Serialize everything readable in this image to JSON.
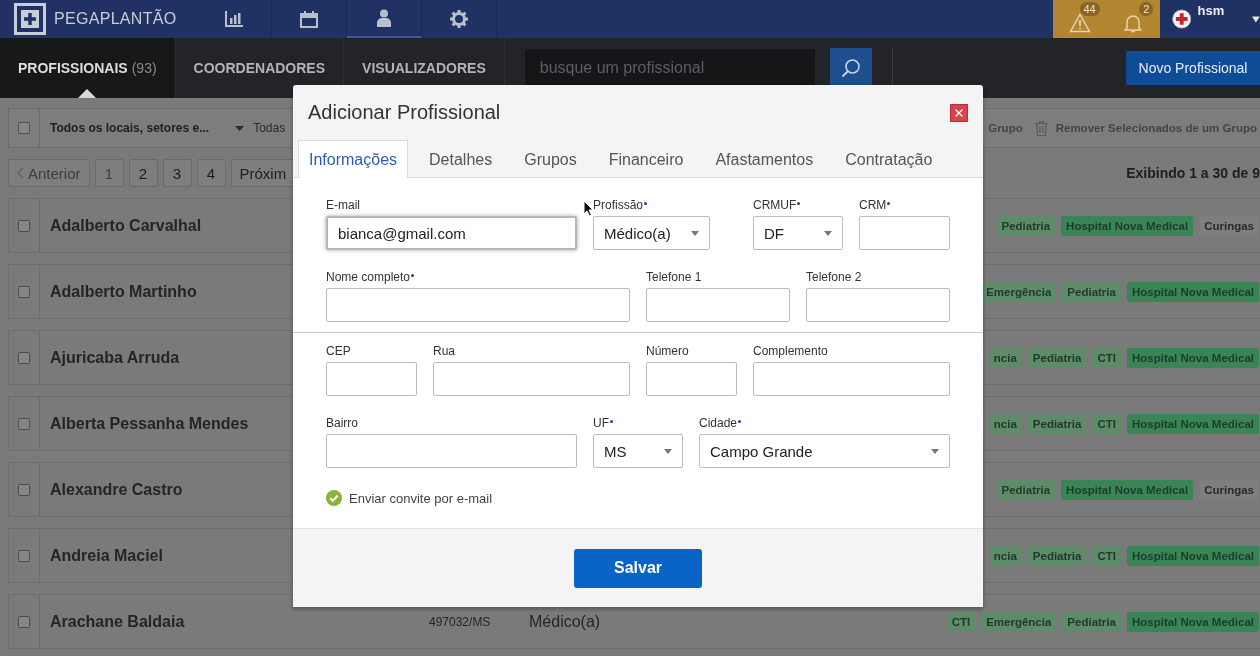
{
  "topbar": {
    "brand": "PEGAPLANTÃO",
    "nav": [
      {
        "selected": false
      },
      {
        "selected": false
      },
      {
        "selected": true
      },
      {
        "selected": false
      }
    ],
    "alerts": [
      {
        "count": "44"
      },
      {
        "count": "2"
      }
    ],
    "user": "hsm"
  },
  "tabs": [
    {
      "label": "PROFISSIONAIS",
      "count": "(93)",
      "selected": true
    },
    {
      "label": "COORDENADORES",
      "selected": false
    },
    {
      "label": "VISUALIZADORES",
      "selected": false
    }
  ],
  "search": {
    "placeholder": "busque um profissional"
  },
  "new_button": "Novo Profissional",
  "toolbar": {
    "checked": false,
    "filter": "Todos os locais, setores e...",
    "filter_2": "Todas",
    "group_action": "Grupo",
    "remove_action": "Remover Selecionados de um Grupo"
  },
  "pagination": {
    "previous": "Anterior",
    "pages": [
      {
        "label": "1",
        "selected": true
      },
      {
        "label": "2",
        "selected": false
      },
      {
        "label": "3",
        "selected": false
      },
      {
        "label": "4",
        "selected": false
      }
    ],
    "next": "Próxim",
    "summary": "Exibindo 1 a 30 de 9"
  },
  "rows": [
    {
      "name": "Adalberto Carvalhal",
      "checked": false,
      "tags": [
        {
          "label": "Pediatria",
          "kind": "specialty"
        },
        {
          "label": "Hospital Nova Medical",
          "kind": "hospital"
        },
        {
          "label": "Curingas",
          "kind": "group"
        }
      ]
    },
    {
      "name": "Adalberto Martinho",
      "checked": false,
      "tags": [
        {
          "label": "Emergência",
          "kind": "specialty"
        },
        {
          "label": "Pediatria",
          "kind": "specialty"
        },
        {
          "label": "Hospital Nova Medical",
          "kind": "hospital"
        }
      ]
    },
    {
      "name": "Ajuricaba Arruda",
      "checked": false,
      "tags": [
        {
          "label": "ncia",
          "kind": "specialty"
        },
        {
          "label": "Pediatria",
          "kind": "specialty"
        },
        {
          "label": "CTI",
          "kind": "specialty"
        },
        {
          "label": "Hospital Nova Medical",
          "kind": "hospital"
        }
      ]
    },
    {
      "name": "Alberta Pessanha Mendes",
      "checked": false,
      "tags": [
        {
          "label": "ncia",
          "kind": "specialty"
        },
        {
          "label": "Pediatria",
          "kind": "specialty"
        },
        {
          "label": "CTI",
          "kind": "specialty"
        },
        {
          "label": "Hospital Nova Medical",
          "kind": "hospital"
        }
      ]
    },
    {
      "name": "Alexandre Castro",
      "checked": false,
      "tags": [
        {
          "label": "Pediatria",
          "kind": "specialty"
        },
        {
          "label": "Hospital Nova Medical",
          "kind": "hospital"
        },
        {
          "label": "Curingas",
          "kind": "group"
        }
      ]
    },
    {
      "name": "Andreia Maciel",
      "checked": false,
      "tags": [
        {
          "label": "ncia",
          "kind": "specialty"
        },
        {
          "label": "Pediatria",
          "kind": "specialty"
        },
        {
          "label": "CTI",
          "kind": "specialty"
        },
        {
          "label": "Hospital Nova Medical",
          "kind": "hospital"
        }
      ]
    },
    {
      "name": "Arachane Baldaia",
      "checked": false,
      "crm": "497032/MS",
      "profession": "Médico(a)",
      "tags": [
        {
          "label": "CTI",
          "kind": "specialty"
        },
        {
          "label": "Emergência",
          "kind": "specialty"
        },
        {
          "label": "Pediatria",
          "kind": "specialty"
        },
        {
          "label": "Hospital Nova Medical",
          "kind": "hospital"
        }
      ]
    }
  ],
  "modal": {
    "title": "Adicionar Profissional",
    "tabs": [
      {
        "label": "Informações",
        "selected": true
      },
      {
        "label": "Detalhes",
        "selected": false
      },
      {
        "label": "Grupos",
        "selected": false
      },
      {
        "label": "Financeiro",
        "selected": false
      },
      {
        "label": "Afastamentos",
        "selected": false
      },
      {
        "label": "Contratação",
        "selected": false
      }
    ],
    "sections": [
      {
        "rows": [
          {
            "fields": [
              {
                "label": "E-mail",
                "kind": "text",
                "value": "bianca@gmail.com",
                "required": false,
                "focused": true
              },
              {
                "label": "Profissão",
                "kind": "select",
                "value": "Médico(a)",
                "required": true,
                "focused": false
              },
              {
                "label": "CRMUF",
                "kind": "select",
                "value": "DF",
                "required": true,
                "focused": false
              },
              {
                "label": "CRM",
                "kind": "text",
                "required": true,
                "focused": false
              }
            ]
          },
          {
            "fields": [
              {
                "label": "Nome completo",
                "kind": "text",
                "required": true,
                "focused": false
              },
              {
                "label": "Telefone 1",
                "kind": "text",
                "required": false,
                "focused": false
              },
              {
                "label": "Telefone 2",
                "kind": "text",
                "required": false,
                "focused": false
              }
            ]
          }
        ]
      },
      {
        "rows": [
          {
            "fields": [
              {
                "label": "CEP",
                "kind": "text",
                "required": false,
                "focused": false
              },
              {
                "label": "Rua",
                "kind": "text",
                "required": false,
                "focused": false
              },
              {
                "label": "Número",
                "kind": "text",
                "required": false,
                "focused": false
              },
              {
                "label": "Complemento",
                "kind": "text",
                "required": false,
                "focused": false
              }
            ]
          },
          {
            "fields": [
              {
                "label": "Bairro",
                "kind": "text",
                "required": false,
                "focused": false
              },
              {
                "label": "UF",
                "kind": "select",
                "value": "MS",
                "required": true,
                "focused": false
              },
              {
                "label": "Cidade",
                "kind": "select",
                "value": "Campo Grande",
                "required": true,
                "focused": false
              }
            ]
          }
        ]
      }
    ],
    "invite": {
      "label": "Enviar convite por e-mail",
      "checked": true
    },
    "save": "Salvar"
  }
}
